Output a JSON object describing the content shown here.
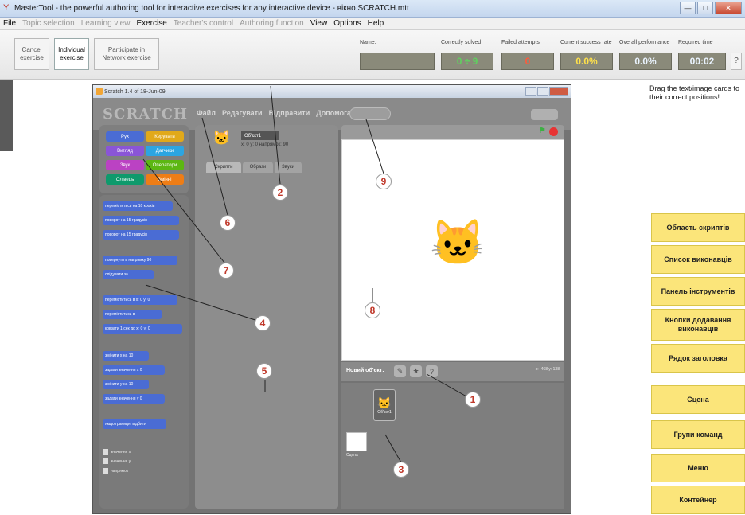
{
  "window": {
    "title": "MasterTool - the powerful authoring tool for interactive exercises for any interactive device - вікно SCRATCH.mtt"
  },
  "menu": [
    {
      "label": "File",
      "dim": false
    },
    {
      "label": "Topic selection",
      "dim": true
    },
    {
      "label": "Learning view",
      "dim": true
    },
    {
      "label": "Exercise",
      "dim": false
    },
    {
      "label": "Teacher's control",
      "dim": true
    },
    {
      "label": "Authoring function",
      "dim": true
    },
    {
      "label": "View",
      "dim": false
    },
    {
      "label": "Options",
      "dim": false
    },
    {
      "label": "Help",
      "dim": false
    }
  ],
  "toolbar": {
    "cancel": "Cancel exercise",
    "individual": "Individual exercise",
    "network": "Participate in Network exercise"
  },
  "stats": {
    "name_label": "Name:",
    "correct_label": "Correctly solved",
    "correct_value": "0 ÷ 9",
    "failed_label": "Failed attempts",
    "failed_value": "0",
    "success_label": "Current success rate",
    "success_value": "0.0%",
    "overall_label": "Overall performance",
    "overall_value": "0.0%",
    "time_label": "Required time",
    "time_value": "00:02"
  },
  "scratch": {
    "title": "Scratch 1.4 of 18-Jun-09",
    "logo": "SCRATCH",
    "menu": [
      "Файл",
      "Редагувати",
      "Відправити",
      "Допомога"
    ],
    "categories": [
      "Рух",
      "Вигляд",
      "Звук",
      "Олівець",
      "Керувати",
      "Датчики",
      "Оператори",
      "Змінні"
    ],
    "blocks": [
      "переміститись на 10 кроків",
      "поворот на 15 градусів",
      "поворот на 15 градусів",
      "повернути в напрямку 90",
      "слідувати за",
      "переміститись в x: 0 y: 0",
      "переміститись в",
      "ковзати 1 сек до x: 0 y: 0",
      "змінити x на 10",
      "задати значення x 0",
      "змінити y на 10",
      "задати значення y 0",
      "якщо границя, відбити"
    ],
    "checkboxes": [
      "значення x",
      "значення y",
      "напрямок"
    ],
    "sprite_name": "Об'єкт1",
    "coords": "x: 0   y: 0   напрямок: 90",
    "tabs": [
      "Скрипти",
      "Образи",
      "Звуки"
    ],
    "new_sprite_label": "Новий об'єкт:",
    "mouse_xy": "x: -468  y: 138",
    "sprite_thumb_label": "Об'єкт1",
    "stage_label": "Сцена"
  },
  "callouts": [
    "1",
    "2",
    "3",
    "4",
    "5",
    "6",
    "7",
    "8",
    "9"
  ],
  "instructions": "Drag the text/image cards to their correct positions!",
  "cards": [
    "Область скриптів",
    "Список виконавців",
    "Панель інструментів",
    "Кнопки додавання виконавців",
    "Рядок заголовка",
    "Сцена",
    "Групи команд",
    "Меню",
    "Контейнер"
  ],
  "colors": {
    "card_bg": "#fbe57a",
    "callout_text": "#c0392b",
    "block_motion": "#4a6cd4"
  }
}
